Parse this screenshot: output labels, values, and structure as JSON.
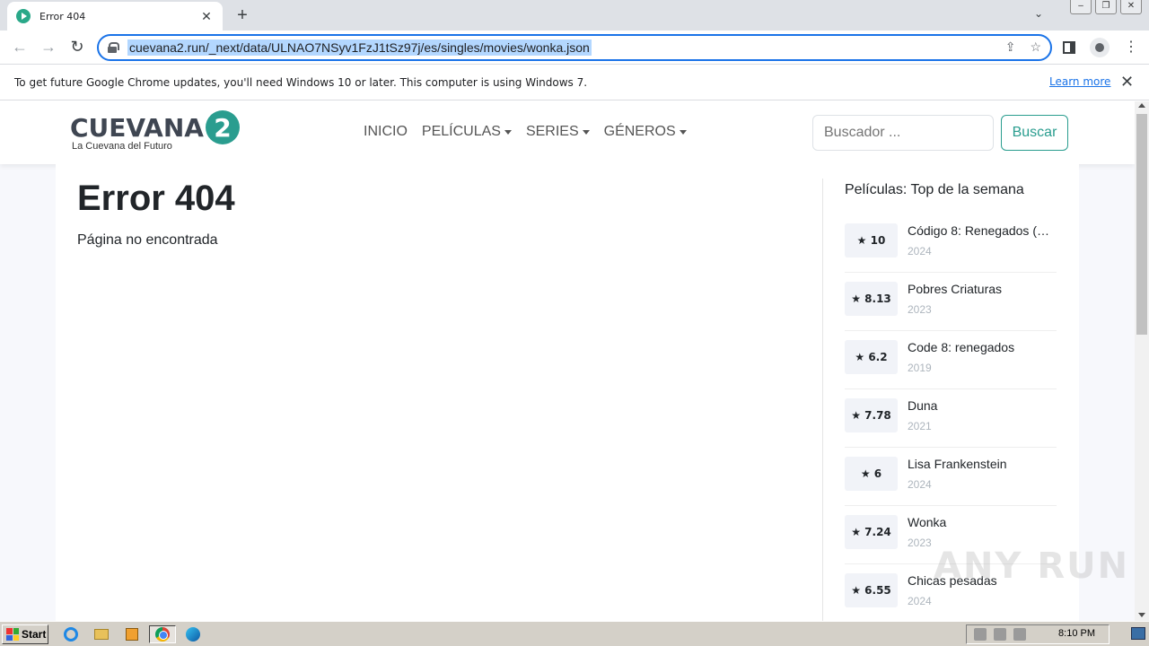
{
  "browser": {
    "tab_title": "Error 404",
    "url": "cuevana2.run/_next/data/ULNAO7NSyv1FzJ1tSz97j/es/singles/movies/wonka.json",
    "infobar_text": "To get future Google Chrome updates, you'll need Windows 10 or later. This computer is using Windows 7.",
    "learn_more": "Learn more"
  },
  "site": {
    "logo_text": "CUEVANA",
    "logo_number": "2",
    "logo_tagline": "La Cuevana del Futuro",
    "nav": [
      "INICIO",
      "PELÍCULAS",
      "SERIES",
      "GÉNEROS"
    ],
    "search_placeholder": "Buscador ...",
    "search_button": "Buscar"
  },
  "main": {
    "error_title": "Error 404",
    "error_message": "Página no encontrada"
  },
  "sidebar": {
    "title": "Películas: Top de la semana",
    "movies": [
      {
        "rating": "★ 10",
        "title": "Código 8: Renegados (…",
        "year": "2024"
      },
      {
        "rating": "★ 8.13",
        "title": "Pobres Criaturas",
        "year": "2023"
      },
      {
        "rating": "★ 6.2",
        "title": "Code 8: renegados",
        "year": "2019"
      },
      {
        "rating": "★ 7.78",
        "title": "Duna",
        "year": "2021"
      },
      {
        "rating": "★ 6",
        "title": "Lisa Frankenstein",
        "year": "2024"
      },
      {
        "rating": "★ 7.24",
        "title": "Wonka",
        "year": "2023"
      },
      {
        "rating": "★ 6.55",
        "title": "Chicas pesadas",
        "year": "2024"
      }
    ]
  },
  "watermark": "ANY RUN",
  "taskbar": {
    "start_label": "Start",
    "clock": "8:10 PM"
  },
  "colors": {
    "accent": "#2a9d8f",
    "omnibox_focus": "#1a73e8"
  }
}
